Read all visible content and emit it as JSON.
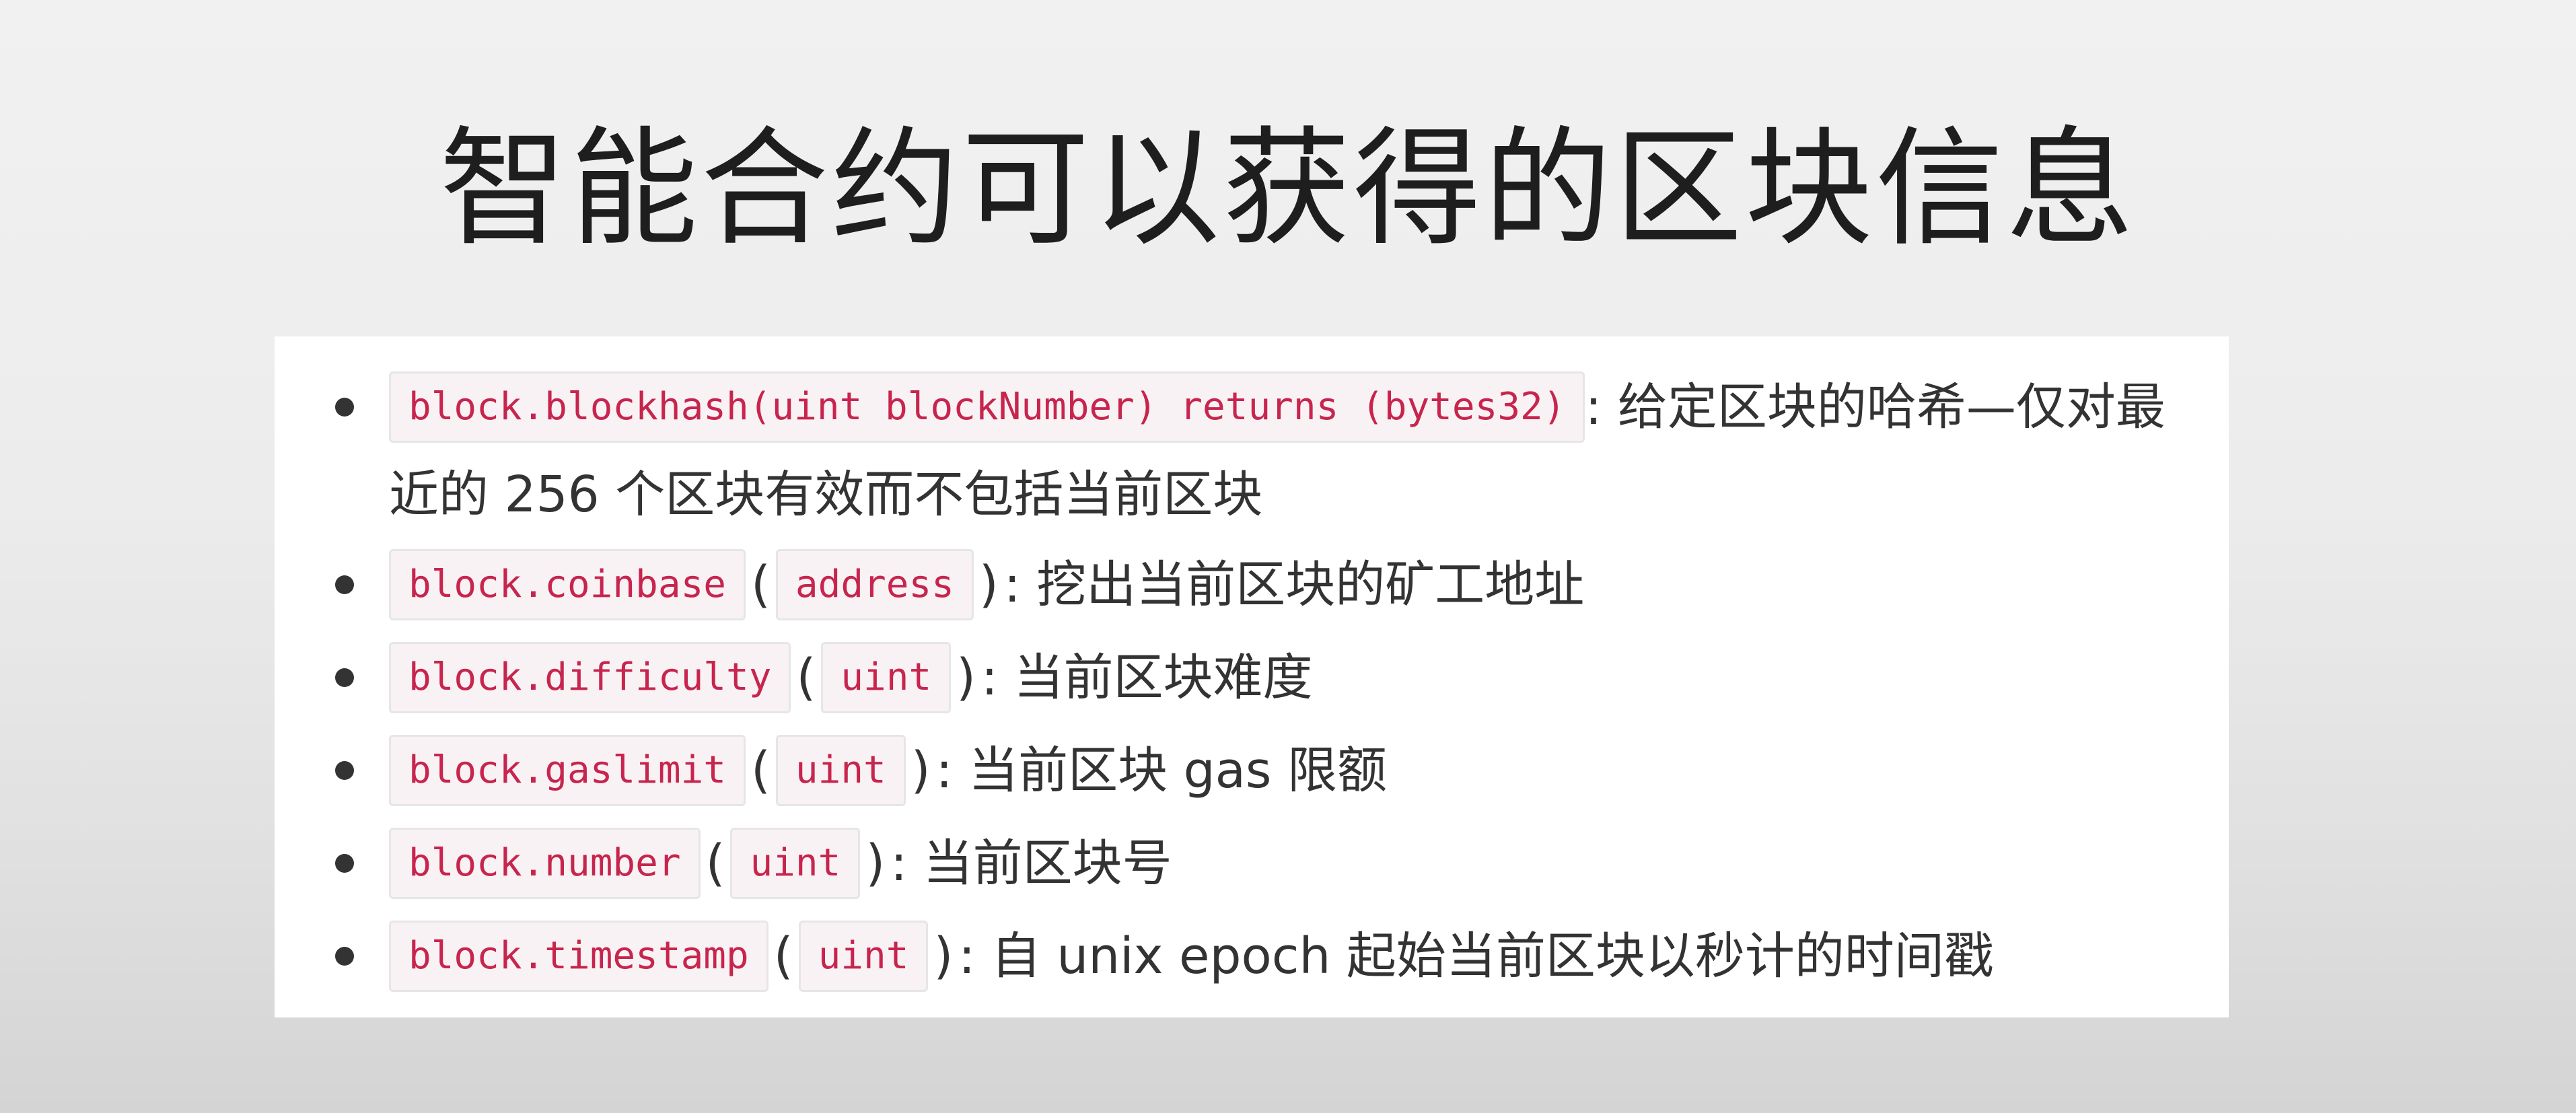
{
  "slide": {
    "title": "智能合约可以获得的区块信息"
  },
  "items": [
    {
      "code": "block.blockhash(uint blockNumber) returns (bytes32)",
      "desc": ": 给定区块的哈希—仅对最近的 256 个区块有效而不包括当前区块"
    },
    {
      "code": "block.coinbase",
      "open": "(",
      "type": "address",
      "close": ")",
      "desc": ": 挖出当前区块的矿工地址"
    },
    {
      "code": "block.difficulty",
      "open": "(",
      "type": "uint",
      "close": ")",
      "desc": ": 当前区块难度"
    },
    {
      "code": "block.gaslimit",
      "open": "(",
      "type": "uint",
      "close": ")",
      "desc": ": 当前区块 gas 限额"
    },
    {
      "code": "block.number",
      "open": "(",
      "type": "uint",
      "close": ")",
      "desc": ": 当前区块号"
    },
    {
      "code": "block.timestamp",
      "open": "(",
      "type": "uint",
      "close": ")",
      "desc": ": 自 unix epoch 起始当前区块以秒计的时间戳"
    }
  ]
}
